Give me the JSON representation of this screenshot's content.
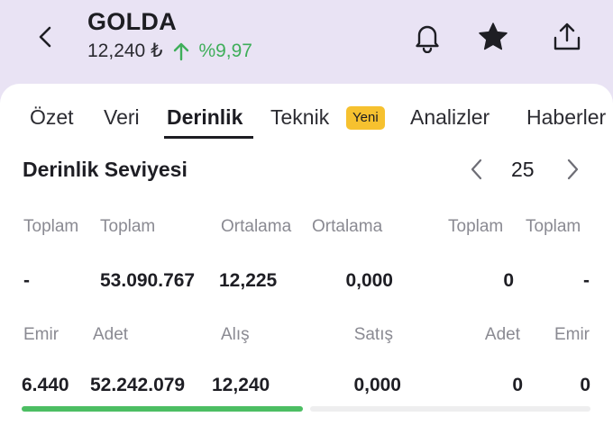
{
  "header": {
    "title": "GOLDA",
    "price": "12,240 ₺",
    "change_pct": "%9,97",
    "colors": {
      "up": "#3fae5a",
      "header_bg": "#e9e3f4"
    },
    "icons": [
      "back-chevron-icon",
      "bell-icon",
      "star-icon",
      "share-icon"
    ]
  },
  "tabs": [
    {
      "label": "Özet"
    },
    {
      "label": "Veri"
    },
    {
      "label": "Derinlik",
      "active": true
    },
    {
      "label": "Teknik",
      "badge": "Yeni"
    },
    {
      "label": "Analizler"
    },
    {
      "label": "Haberler"
    }
  ],
  "depth": {
    "title": "Derinlik Seviyesi",
    "level": "25",
    "summary_headers": [
      "Toplam",
      "Toplam",
      "Ortalama",
      "Ortalama",
      "Toplam",
      "Toplam"
    ],
    "summary_values": [
      "-",
      "53.090.767",
      "12,225",
      "0,000",
      "0",
      "-"
    ],
    "column_headers": [
      "Emir",
      "Adet",
      "Alış",
      "Satış",
      "Adet",
      "Emir"
    ],
    "rows": [
      {
        "buy_orders": "6.440",
        "buy_qty": "52.242.079",
        "bid": "12,240",
        "ask": "0,000",
        "sell_qty": "0",
        "sell_orders": "0"
      }
    ],
    "colors": {
      "buy_bar": "#4cbe63",
      "sell_bar": "#eeeeef",
      "badge": "#f6c12f"
    }
  }
}
